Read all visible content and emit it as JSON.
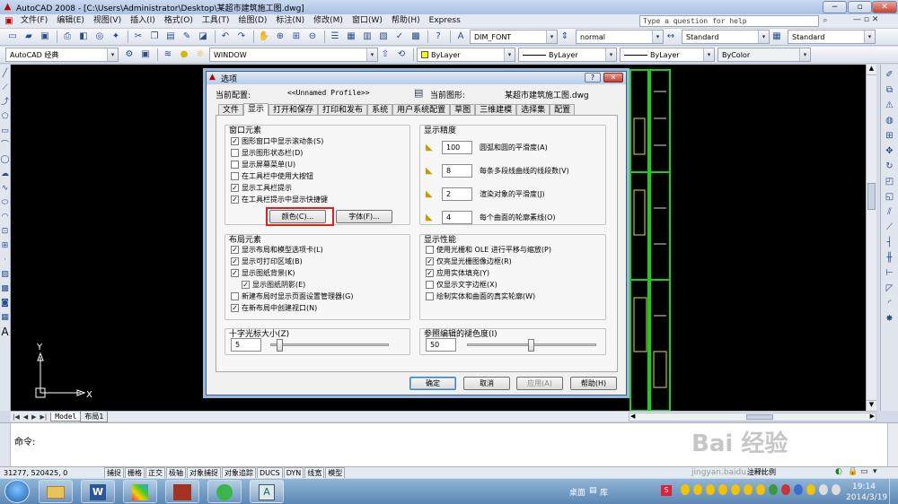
{
  "titlebar": {
    "title": "AutoCAD 2008 - [C:\\Users\\Administrator\\Desktop\\某超市建筑施工图.dwg]",
    "minimize": "−",
    "restore": "▫",
    "close": "✕"
  },
  "menubar": {
    "items": [
      "文件(F)",
      "编辑(E)",
      "视图(V)",
      "插入(I)",
      "格式(O)",
      "工具(T)",
      "绘图(D)",
      "标注(N)",
      "修改(M)",
      "窗口(W)",
      "帮助(H)",
      "Express"
    ],
    "help_placeholder": "Type a question for help"
  },
  "toolbar1": {
    "textstyle": "DIM_FONT",
    "textheight": "normal",
    "dimstyle": "Standard",
    "tablestyle": "Standard"
  },
  "toolbar2": {
    "workspace": "AutoCAD 经典",
    "layer": "WINDOW",
    "color": "ByLayer",
    "linetype": "ByLayer",
    "lineweight": "ByLayer",
    "plotstyle": "ByColor"
  },
  "dialog": {
    "title": "选项",
    "current_profile_label": "当前配置:",
    "current_profile_value": "<<Unnamed Profile>>",
    "current_drawing_label": "当前图形:",
    "current_drawing_value": "某超市建筑施工图.dwg",
    "tabs": [
      "文件",
      "显示",
      "打开和保存",
      "打印和发布",
      "系统",
      "用户系统配置",
      "草图",
      "三维建模",
      "选择集",
      "配置"
    ],
    "window_elements": {
      "label": "窗口元素",
      "options": [
        {
          "label": "图形窗口中显示滚动条(S)",
          "checked": true
        },
        {
          "label": "显示图形状态栏(D)",
          "checked": false
        },
        {
          "label": "显示屏幕菜单(U)",
          "checked": false
        },
        {
          "label": "在工具栏中使用大按钮",
          "checked": false
        },
        {
          "label": "显示工具栏提示",
          "checked": true
        },
        {
          "label": "在工具栏提示中显示快捷键",
          "checked": true
        }
      ],
      "colors_button": "颜色(C)...",
      "fonts_button": "字体(F)..."
    },
    "display_resolution": {
      "label": "显示精度",
      "items": [
        {
          "value": "100",
          "label": "圆弧和圆的平滑度(A)"
        },
        {
          "value": "8",
          "label": "每条多段线曲线的线段数(V)"
        },
        {
          "value": "2",
          "label": "渲染对象的平滑度(J)"
        },
        {
          "value": "4",
          "label": "每个曲面的轮廓素线(O)"
        }
      ]
    },
    "layout_elements": {
      "label": "布局元素",
      "options": [
        {
          "label": "显示布局和模型选项卡(L)",
          "checked": true,
          "indent": false
        },
        {
          "label": "显示可打印区域(B)",
          "checked": true,
          "indent": false
        },
        {
          "label": "显示图纸背景(K)",
          "checked": true,
          "indent": false
        },
        {
          "label": "显示图纸阴影(E)",
          "checked": true,
          "indent": true
        },
        {
          "label": "新建布局时显示页面设置管理器(G)",
          "checked": false,
          "indent": false
        },
        {
          "label": "在新布局中创建视口(N)",
          "checked": true,
          "indent": false
        }
      ]
    },
    "display_performance": {
      "label": "显示性能",
      "options": [
        {
          "label": "使用光栅和 OLE 进行平移与缩放(P)",
          "checked": false
        },
        {
          "label": "仅亮显光栅图像边框(R)",
          "checked": true
        },
        {
          "label": "应用实体填充(Y)",
          "checked": true
        },
        {
          "label": "仅显示文字边框(X)",
          "checked": false
        },
        {
          "label": "绘制实体和曲面的真实轮廓(W)",
          "checked": false
        }
      ]
    },
    "crosshair": {
      "label": "十字光标大小(Z)",
      "value": "5",
      "slider_fraction": 0.05
    },
    "fade": {
      "label": "参照编辑的褪色度(I)",
      "value": "50",
      "slider_fraction": 0.5
    },
    "buttons": {
      "ok": "确定",
      "cancel": "取消",
      "apply": "应用(A)",
      "help": "帮助(H)"
    }
  },
  "model_tabs": [
    "Model",
    "布局1"
  ],
  "command": {
    "prompt": "命令:"
  },
  "status": {
    "coords": "31277,   520425, 0",
    "toggles": [
      "捕捉",
      "栅格",
      "正交",
      "极轴",
      "对象捕捉",
      "对象追踪",
      "DUCS",
      "DYN",
      "线宽",
      "模型"
    ],
    "annotation_scale": "注释比例"
  },
  "taskbar": {
    "desktop": "桌面",
    "library": "库",
    "time": "19:14",
    "date": "2014/3/19"
  },
  "watermark": {
    "text": "Bai 经验",
    "url": "jingyan.baidu.com"
  },
  "colors": {
    "highlight_box": "#e02020",
    "drawing_green": "#18d018",
    "drawing_yellow": "#e8e020",
    "drawing_bg": "#000000"
  }
}
